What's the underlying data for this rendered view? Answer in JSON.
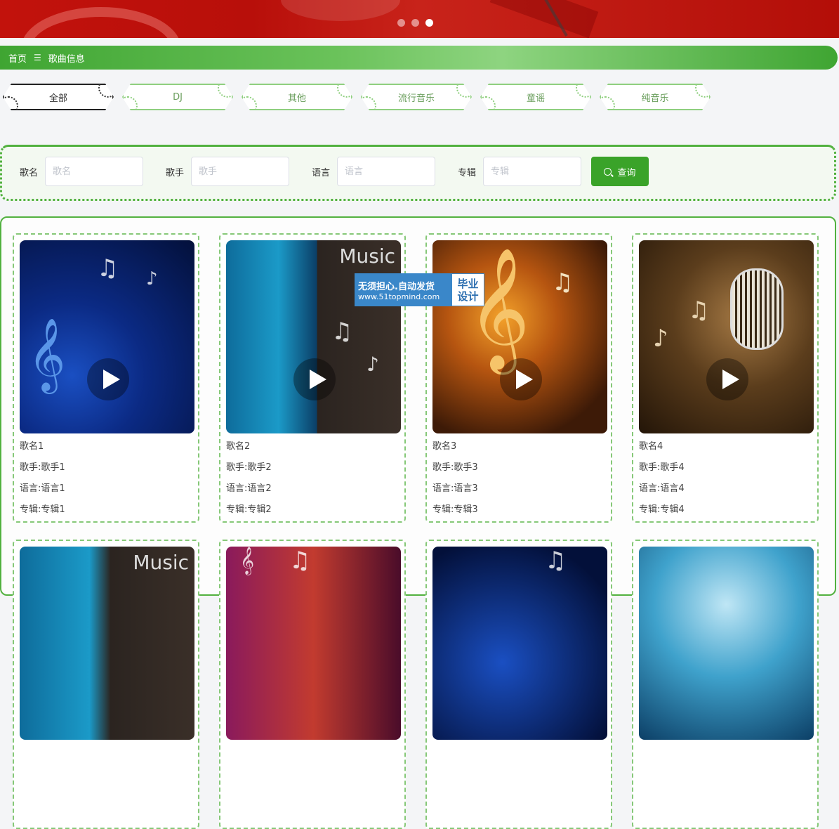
{
  "carousel": {
    "slides": 3,
    "active_index": 2
  },
  "breadcrumb": {
    "home": "首页",
    "separator": "☰",
    "current": "歌曲信息"
  },
  "categories": [
    "全部",
    "DJ",
    "其他",
    "流行音乐",
    "童谣",
    "纯音乐"
  ],
  "active_category": "全部",
  "search": {
    "song_label": "歌名",
    "song_placeholder": "歌名",
    "singer_label": "歌手",
    "singer_placeholder": "歌手",
    "language_label": "语言",
    "language_placeholder": "语言",
    "album_label": "专辑",
    "album_placeholder": "专辑",
    "button_label": "查询"
  },
  "songs": [
    {
      "name": "歌名1",
      "singer": "歌手:歌手1",
      "language": "语言:语言1",
      "album": "专辑:专辑1"
    },
    {
      "name": "歌名2",
      "singer": "歌手:歌手2",
      "language": "语言:语言2",
      "album": "专辑:专辑2"
    },
    {
      "name": "歌名3",
      "singer": "歌手:歌手3",
      "language": "语言:语言3",
      "album": "专辑:专辑3"
    },
    {
      "name": "歌名4",
      "singer": "歌手:歌手4",
      "language": "语言:语言4",
      "album": "专辑:专辑4"
    }
  ],
  "cover_texts": {
    "music": "Music"
  },
  "watermark": {
    "line1": "无须担心.自动发货",
    "line2": "www.51topmind.com",
    "side1": "毕业",
    "side2": "设计"
  },
  "colors": {
    "accent": "#3aa329",
    "banner": "#c2120c",
    "card_border": "#86c878"
  }
}
